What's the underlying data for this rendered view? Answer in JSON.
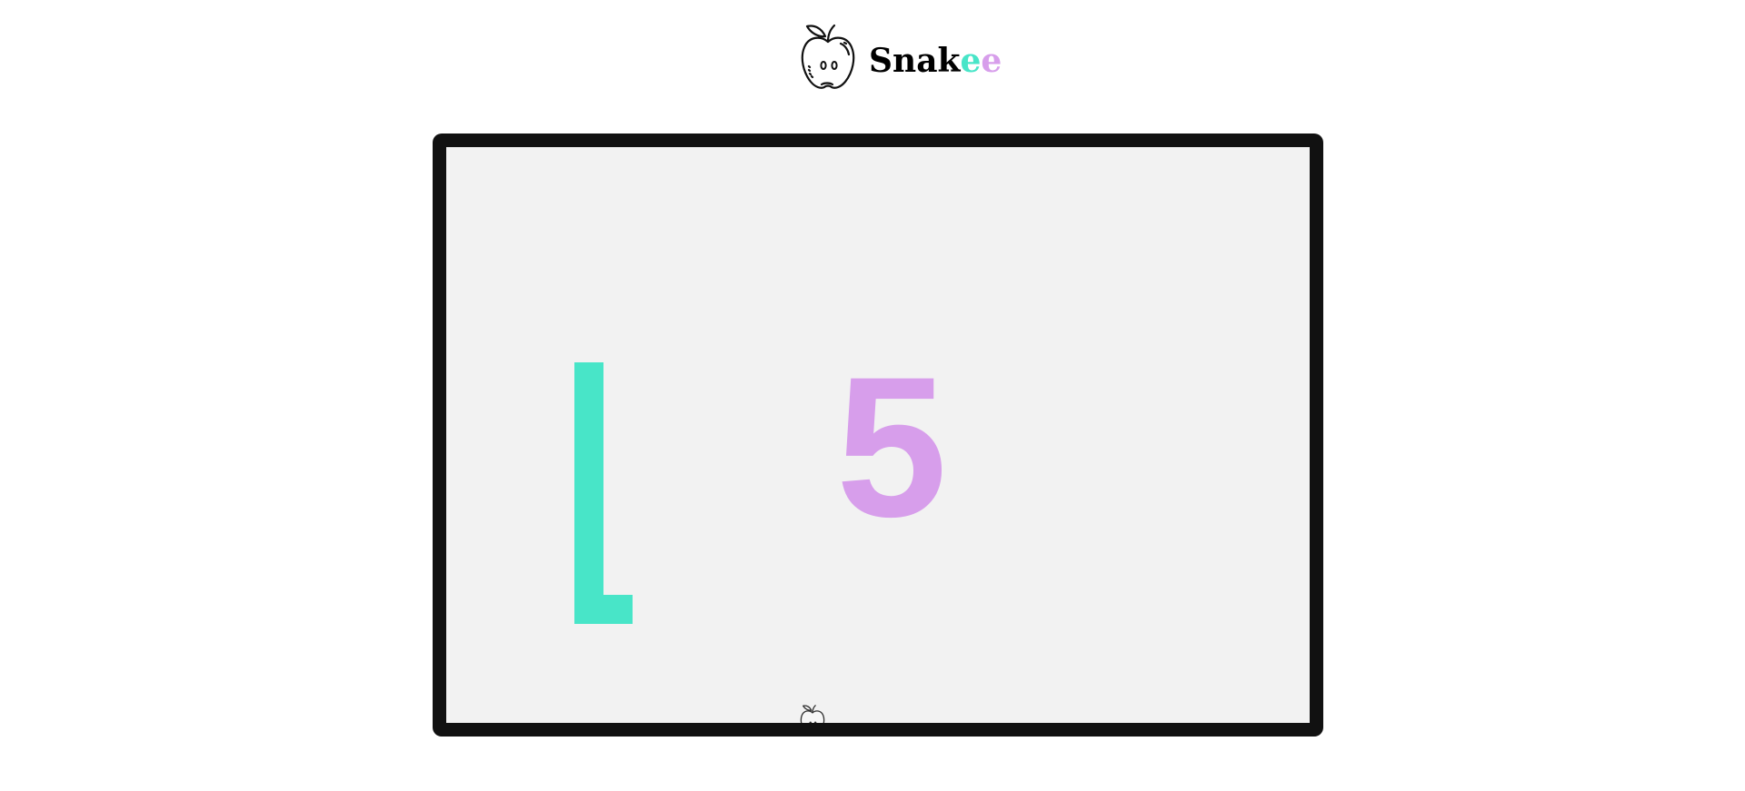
{
  "header": {
    "title_letters": [
      "S",
      "n",
      "a",
      "k",
      "e",
      "e"
    ],
    "title_colors": [
      "#000000",
      "#000000",
      "#000000",
      "#000000",
      "#48e5c8",
      "#d79eeb"
    ],
    "logo_icon": "apple-icon"
  },
  "game": {
    "score": "5",
    "snake_color": "#48e5c8",
    "score_color": "#d79eeb",
    "board_background": "#f2f2f2",
    "board_border_color": "#111111",
    "food_icon": "apple-icon"
  }
}
